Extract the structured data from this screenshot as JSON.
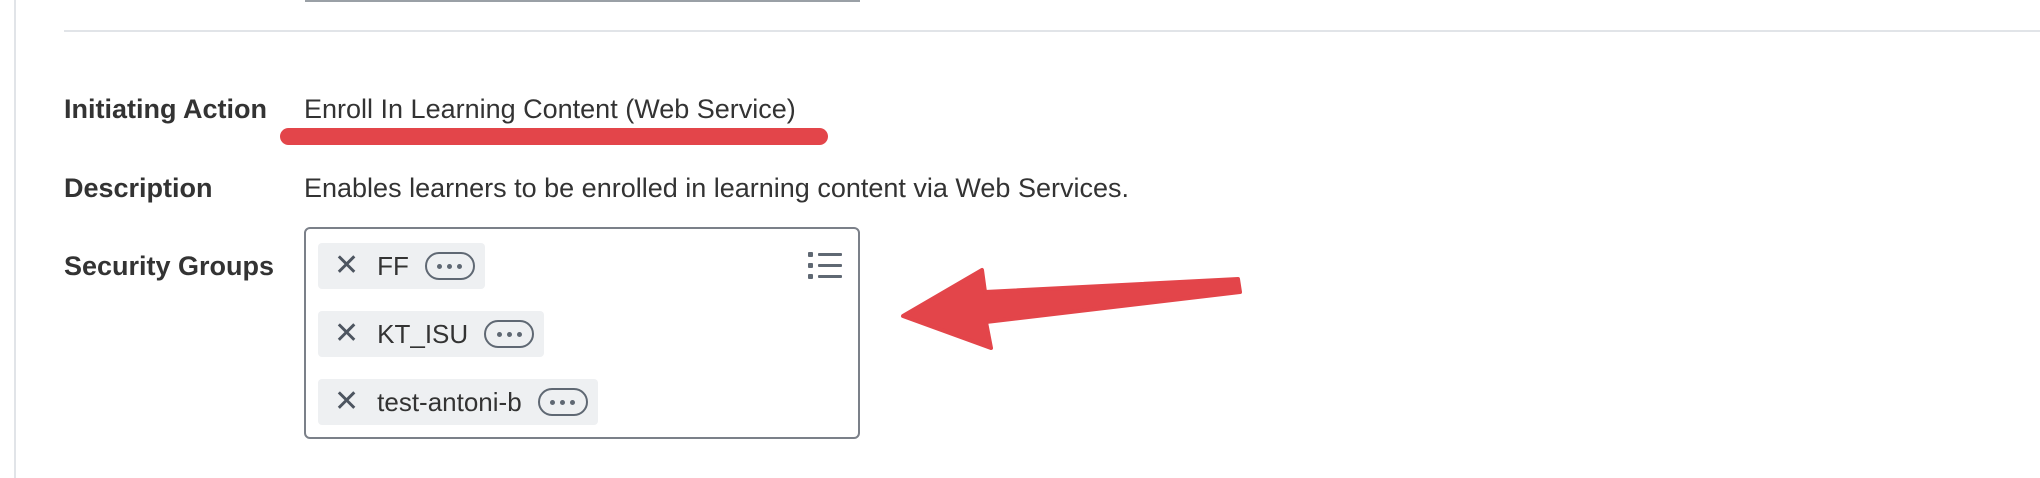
{
  "fields": {
    "initiating_action": {
      "label": "Initiating Action",
      "value": "Enroll In Learning Content (Web Service)"
    },
    "description": {
      "label": "Description",
      "value": "Enables learners to be enrolled in learning content via Web Services."
    },
    "security_groups": {
      "label": "Security Groups",
      "items": [
        "FF",
        "KT_ISU",
        "test-antoni-b"
      ]
    }
  },
  "icons": {
    "remove": "close-icon",
    "more": "more-horizontal-icon",
    "list": "list-icon"
  },
  "colors": {
    "annotation": "#e3454a",
    "text": "#333333",
    "pill_bg": "#eef0f2"
  }
}
